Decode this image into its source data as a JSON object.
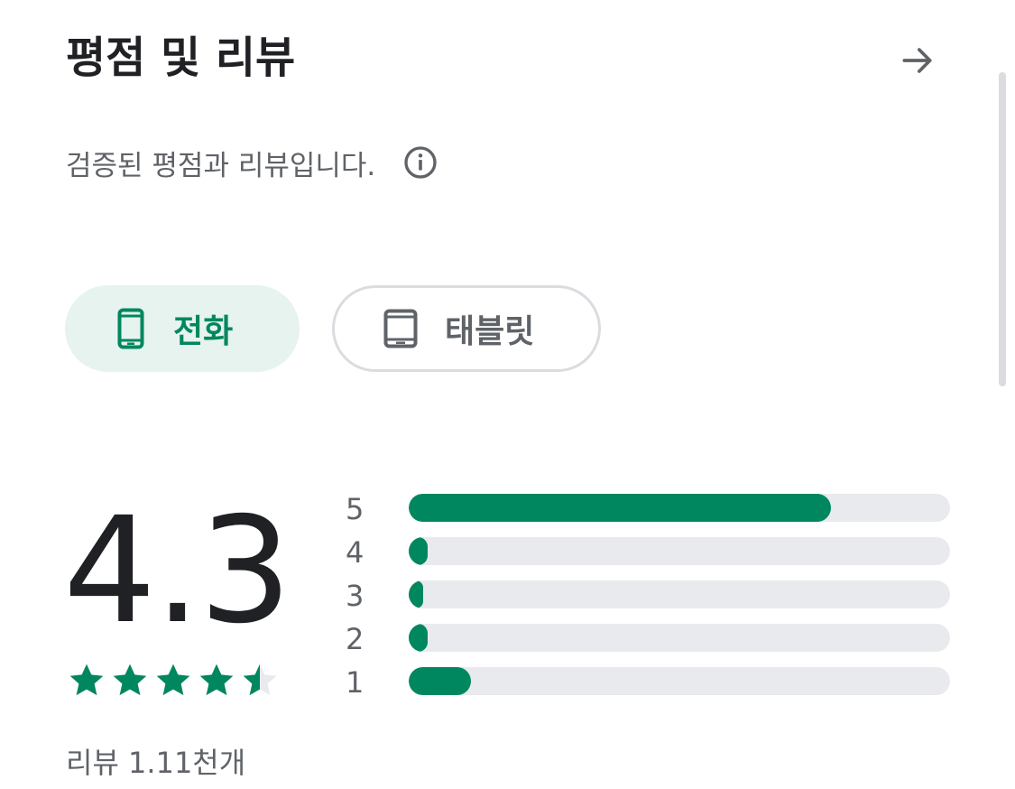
{
  "header": {
    "title": "평점 및 리뷰"
  },
  "subtitle": {
    "text": "검증된 평점과 리뷰입니다."
  },
  "chips": [
    {
      "label": "전화",
      "selected": true,
      "icon": "phone-icon"
    },
    {
      "label": "태블릿",
      "selected": false,
      "icon": "tablet-icon"
    }
  ],
  "rating": {
    "value": "4.3",
    "stars": 4.3,
    "review_count": "리뷰 1.11천개"
  },
  "histogram": [
    {
      "label": "5",
      "fraction": 0.78
    },
    {
      "label": "4",
      "fraction": 0.035
    },
    {
      "label": "3",
      "fraction": 0.027
    },
    {
      "label": "2",
      "fraction": 0.035
    },
    {
      "label": "1",
      "fraction": 0.115
    }
  ],
  "colors": {
    "accent": "#01875f",
    "chip_selected_bg": "#e6f3ee",
    "track": "#e8eaed",
    "text_primary": "#202124",
    "text_secondary": "#5f6368"
  }
}
